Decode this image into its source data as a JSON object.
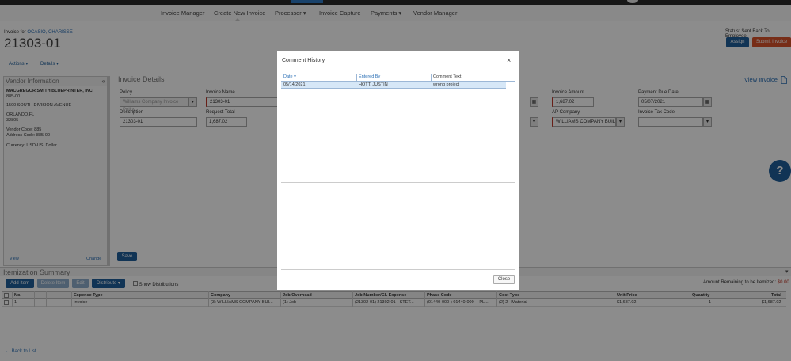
{
  "nav": {
    "items": [
      "Invoice Manager",
      "Create New Invoice",
      "Processor ▾",
      "Invoice Capture",
      "Payments ▾",
      "Vendor Manager"
    ]
  },
  "header": {
    "invoice_for_prefix": "Invoice for",
    "invoice_for_name": "OCASIO, CHARISSE",
    "invoice_number": "21303-01",
    "status": "Status: Sent Back To Employee",
    "assign_label": "Assign",
    "submit_label": "Submit Invoice",
    "actions_label": "Actions ▾",
    "details_label": "Details ▾"
  },
  "vendor": {
    "header": "Vendor Information",
    "collapse_icon": "double-chevron-left-icon",
    "name": "MACGREGOR SMITH BLUEPRINTER, INC",
    "code_line": "885-00",
    "address": "1500 SOUTH DIVISION AVENUE",
    "city": "ORLANDO,FL",
    "zip": "32805",
    "vendor_code": "Vendor Code: 885",
    "address_code": "Address Code: 885-00",
    "currency": "Currency: USD-US. Dollar",
    "view_label": "View",
    "change_label": "Change"
  },
  "details": {
    "title": "Invoice Details",
    "view_invoice": "View Invoice",
    "policy_label": "Policy",
    "policy_value": "Williams Company Invoice Policy",
    "invoice_name_label": "Invoice Name",
    "invoice_name_value": "21303-01",
    "description_label": "Description",
    "description_value": "21303-01",
    "request_total_label": "Request Total",
    "request_total_value": "1,687.02",
    "invoice_amount_label": "Invoice Amount",
    "invoice_amount_value": "1,687.02",
    "payment_due_label": "Payment Due Date",
    "payment_due_value": "05/07/2021",
    "ap_company_label": "AP Company",
    "ap_company_value": "WILLIAMS COMPANY BUILDERS",
    "tax_code_label": "Invoice Tax Code",
    "tax_code_value": "",
    "save_label": "Save"
  },
  "itemization": {
    "title": "Itemization Summary",
    "add_item": "Add Item",
    "delete_item": "Delete Item",
    "edit": "Edit",
    "distribute": "Distribute ▾",
    "show_distributions": "Show Distributions",
    "remaining_label": "Amount Remaining to be Itemized:",
    "remaining_value": "$0.00",
    "columns": [
      "No.",
      "Expense Type",
      "Company",
      "Job/Overhead",
      "Job Number/GL Expense",
      "Phase Code",
      "Cost Type",
      "Unit Price",
      "Quantity",
      "Total"
    ],
    "rows": [
      [
        "1",
        "Invoice",
        "(3) WILLIAMS COMPANY BUI...",
        "(1) Job",
        "(21302-01) 21302-01 - STET...",
        "(01440-000-) 01440-000- - PL...",
        "(2) 2 - Material",
        "$1,687.02",
        "1",
        "$1,687.02"
      ]
    ]
  },
  "footer": {
    "back_label": "← Back to List"
  },
  "modal": {
    "title": "Comment History",
    "close_x": "×",
    "columns": [
      "Date ▾",
      "Entered By",
      "Comment Text"
    ],
    "rows": [
      [
        "05/14/2021",
        "HOTT, JUSTIN",
        "wrong project"
      ]
    ],
    "close_label": "Close"
  },
  "help": {
    "icon": "question-icon",
    "glyph": "?"
  },
  "colors": {
    "accent_blue": "#1f5f9c",
    "submit_red": "#d9532b",
    "required_red": "#c0392b",
    "row_highlight": "#d6e7f7"
  }
}
